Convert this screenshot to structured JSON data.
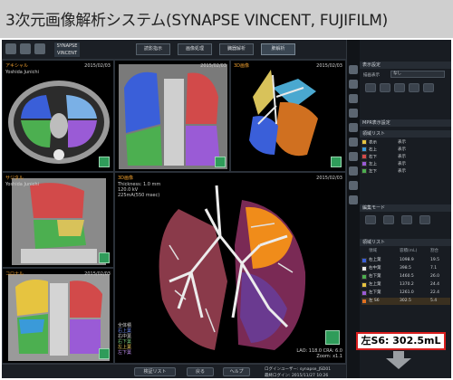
{
  "banner": {
    "title": "3次元画像解析システム(SYNAPSE VINCENT, FUJIFILM)"
  },
  "toolbar": {
    "logo": "SYNAPSE VINCENT",
    "tabs": [
      "読影指示",
      "画像処理",
      "臓器解析",
      "肺解析"
    ]
  },
  "viewports": {
    "axial": {
      "name": "アキシャル",
      "patient": "Yoshida Junichi",
      "date": "2015/02/03"
    },
    "coronal_mpr": {
      "date": "2015/02/03"
    },
    "vr_top": {
      "name": "3D画像",
      "date": "2015/02/03"
    },
    "sagittal": {
      "name": "サジタル",
      "patient": "Yoshida Junichi"
    },
    "coronal": {
      "name": "コロナル",
      "date": "2015/02/03"
    },
    "main3d": {
      "name": "3D画像",
      "info": [
        "Thickness: 1.0 mm",
        "120.0 kV",
        "225mA(550 msec)"
      ],
      "date": "2015/02/03",
      "lower_left": [
        "全体積",
        "右上葉",
        "右中葉",
        "右下葉",
        "左上葉",
        "左下葉"
      ],
      "lower_right": [
        "LAO: 118.0 CRA: 6.0",
        "Zoom: x1.1"
      ]
    }
  },
  "right_panel": {
    "display_setting": "表示設定",
    "display_label": "描画表示",
    "display_value": "なし",
    "mpr_setting": "MPR表示設定",
    "label_list": "領域リスト",
    "label_rows": [
      {
        "color": "#e6c440",
        "name": "表示",
        "state": "表示"
      },
      {
        "color": "#3a9ad9",
        "name": "右上",
        "state": "表示"
      },
      {
        "color": "#d24a4a",
        "name": "右下",
        "state": "表示"
      },
      {
        "color": "#9a5bd6",
        "name": "左上",
        "state": "表示"
      },
      {
        "color": "#4caf50",
        "name": "左下",
        "state": "表示"
      }
    ],
    "edit_mode": "編集モード",
    "region_list_title": "領域リスト",
    "region_header": [
      "領域",
      "容積(mL)",
      "割合"
    ],
    "regions": [
      {
        "color": "#3a5fd9",
        "name": "右上葉",
        "volume": "1098.9",
        "ratio": "19.5"
      },
      {
        "color": "#e6e6e6",
        "name": "右中葉",
        "volume": "398.5",
        "ratio": "7.1"
      },
      {
        "color": "#4caf50",
        "name": "右下葉",
        "volume": "1460.5",
        "ratio": "26.0"
      },
      {
        "color": "#e6c440",
        "name": "左上葉",
        "volume": "1370.2",
        "ratio": "24.4"
      },
      {
        "color": "#9a5bd6",
        "name": "左下葉",
        "volume": "1261.0",
        "ratio": "22.4"
      },
      {
        "color": "#e07020",
        "name": "左 S6",
        "volume": "302.5",
        "ratio": "5.4"
      }
    ]
  },
  "callout": {
    "text": "左S6: 302.5mL"
  },
  "bottombar": {
    "buttons": [
      "検証リスト",
      "戻る",
      "ヘルプ"
    ],
    "user": "ログインユーザー: synapse_JSD01",
    "login": "最終ログイン: 2015/11/27 10:26"
  },
  "colors": {
    "accent_callout": "#d81e1e",
    "lung_blue": "#3a5fd9",
    "lung_green": "#4caf50",
    "lung_yellow": "#e6c440",
    "lung_purple": "#9a5bd6",
    "lung_orange": "#e07020"
  }
}
